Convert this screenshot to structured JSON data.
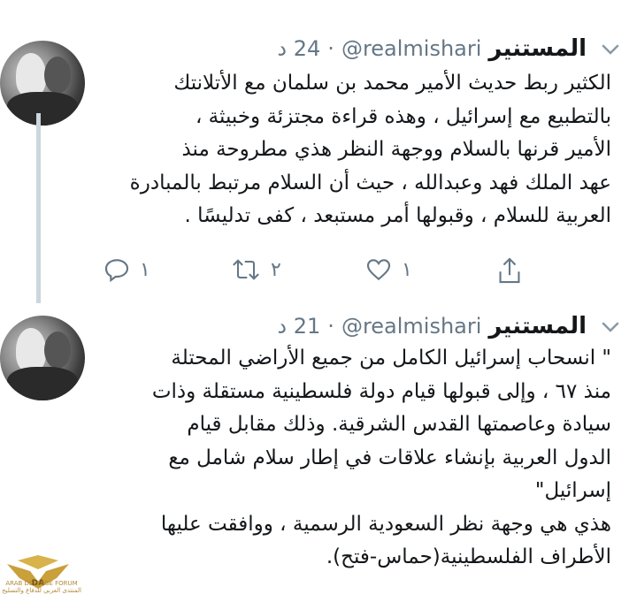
{
  "tweets": [
    {
      "display_name": "المستنير",
      "handle": "@realmishari",
      "separator": "·",
      "time": "24 د",
      "lines": [
        "الكثير ربط حديث الأمير محمد بن سلمان مع الأتلانتك",
        "بالتطبيع مع إسرائيل ، وهذه قراءة مجتزئة وخبيثة ،",
        "الأمير قرنها بالسلام ووجهة النظر هذي مطروحة منذ",
        "عهد الملك فهد وعبدالله ، حيث أن السلام مرتبط بالمبادرة",
        "العربية للسلام ، وقبولها أمر مستبعد ، كفى تدليسًا ."
      ],
      "replies": "١",
      "retweets": "٢",
      "likes": "١"
    },
    {
      "display_name": "المستنير",
      "handle": "@realmishari",
      "separator": "·",
      "time": "21 د",
      "lines": [
        "\" انسحاب إسرائيل الكامل من جميع الأراضي المحتلة",
        "منذ ٦٧ ، وإلى قبولها قيام دولة فلسطينية مستقلة وذات",
        "سيادة وعاصمتها القدس الشرقية. وذلك مقابل قيام",
        "الدول العربية بإنشاء علاقات في إطار سلام شامل مع",
        "إسرائيل\"",
        "هذي هي وجهة نظر السعودية الرسمية ، ووافقت عليها",
        "الأطراف الفلسطينية(حماس-فتح)."
      ]
    }
  ],
  "watermark": {
    "text": "ARAB DEFENSE FORUM",
    "subtext": "المنتدى العربي للدفاع والتسليح"
  },
  "colors": {
    "text": "#14171a",
    "muted": "#657786",
    "thread_line": "#ccd6dd",
    "background": "#ffffff"
  },
  "icons": [
    "reply-icon",
    "retweet-icon",
    "like-icon",
    "share-icon",
    "chevron-down-icon"
  ]
}
